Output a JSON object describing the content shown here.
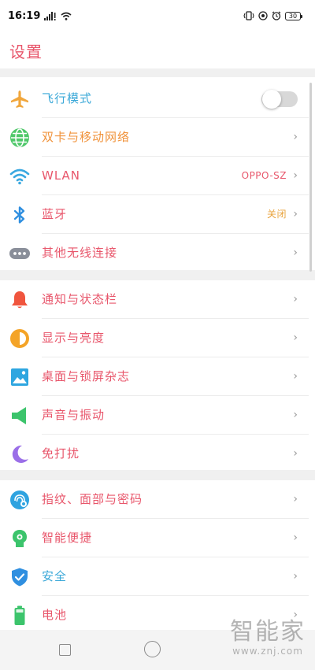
{
  "status_bar": {
    "time": "16:19",
    "battery": "30"
  },
  "page_title": "设置",
  "colors": {
    "title": "#e8566b",
    "label_pink": "#e8566b",
    "label_orange": "#f0923a",
    "label_blue": "#3aa8d8",
    "section_gap": "#f0f0f0"
  },
  "sections": [
    {
      "items": [
        {
          "label": "飞行模式",
          "icon": "airplane-icon",
          "icon_color": "#f1a63b",
          "label_color": "#3aa8d8",
          "control": "toggle",
          "toggle_on": false
        },
        {
          "label": "双卡与移动网络",
          "icon": "globe-icon",
          "icon_color": "#4fc86a",
          "label_color": "#f0923a",
          "control": "chevron"
        },
        {
          "label": "WLAN",
          "icon": "wifi-icon",
          "icon_color": "#3aa8e0",
          "label_color": "#e8566b",
          "value": "OPPO-SZ",
          "value_color": "#e8566b",
          "control": "chevron"
        },
        {
          "label": "蓝牙",
          "icon": "bluetooth-icon",
          "icon_color": "#2f8fe0",
          "label_color": "#e8566b",
          "value": "关闭",
          "value_color": "#e8a23a",
          "control": "chevron"
        },
        {
          "label": "其他无线连接",
          "icon": "more-connections-icon",
          "icon_color": "#8a8f9a",
          "label_color": "#e8566b",
          "control": "chevron"
        }
      ]
    },
    {
      "items": [
        {
          "label": "通知与状态栏",
          "icon": "bell-icon",
          "icon_color": "#f0553e",
          "label_color": "#e8566b",
          "control": "chevron"
        },
        {
          "label": "显示与亮度",
          "icon": "brightness-icon",
          "icon_color": "#f4a428",
          "label_color": "#e8566b",
          "control": "chevron"
        },
        {
          "label": "桌面与锁屏杂志",
          "icon": "wallpaper-icon",
          "icon_color": "#2ea6e0",
          "label_color": "#e8566b",
          "control": "chevron"
        },
        {
          "label": "声音与振动",
          "icon": "speaker-icon",
          "icon_color": "#3cc46c",
          "label_color": "#e8566b",
          "control": "chevron"
        },
        {
          "label": "免打扰",
          "icon": "moon-icon",
          "icon_color": "#9b6fe8",
          "label_color": "#e8566b",
          "control": "chevron"
        }
      ]
    },
    {
      "items": [
        {
          "label": "指纹、面部与密码",
          "icon": "fingerprint-face-icon",
          "icon_color": "#2fa3e0",
          "label_color": "#e8566b",
          "control": "chevron"
        },
        {
          "label": "智能便捷",
          "icon": "smart-assist-icon",
          "icon_color": "#3cc46c",
          "label_color": "#e8566b",
          "control": "chevron"
        },
        {
          "label": "安全",
          "icon": "shield-icon",
          "icon_color": "#2f8fe0",
          "label_color": "#3aa8d8",
          "control": "chevron"
        },
        {
          "label": "电池",
          "icon": "battery-icon",
          "icon_color": "#3cc46c",
          "label_color": "#e8566b",
          "control": "chevron"
        }
      ]
    }
  ],
  "chevron_glyph": "›",
  "watermark": {
    "main": "智能家",
    "sub": "www.znj.com"
  }
}
